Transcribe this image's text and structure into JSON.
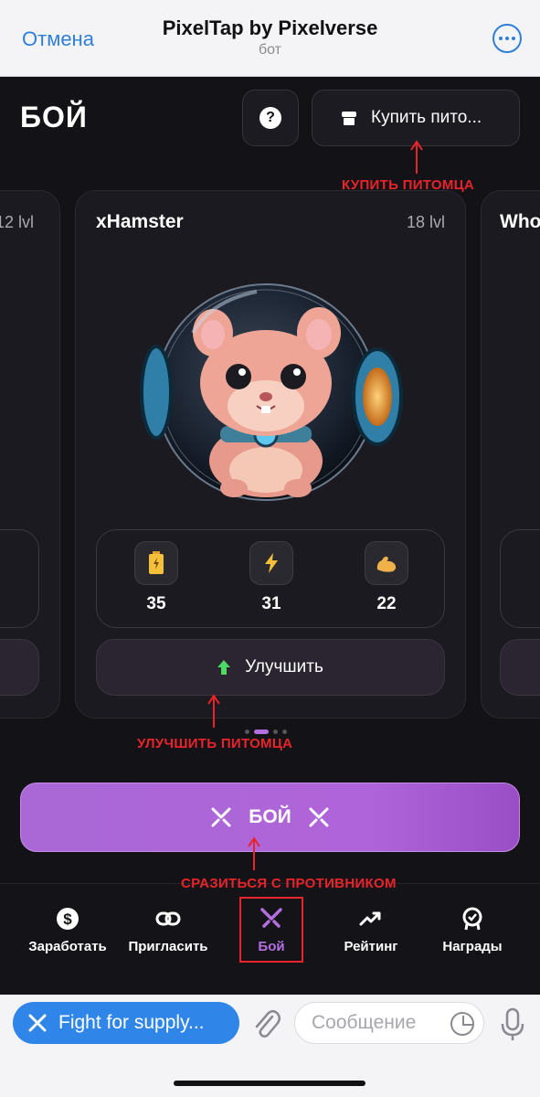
{
  "telegram_header": {
    "cancel_label": "Отмена",
    "title": "PixelTap by Pixelverse",
    "subtitle": "бот"
  },
  "app": {
    "page_title": "БОЙ",
    "help_label": "?",
    "buy_pet_label": "Купить пито...",
    "annotations": {
      "buy_pet": "КУПИТЬ ПИТОМЦА",
      "upgrade_pet": "УЛУЧШИТЬ ПИТОМЦА",
      "fight_opponent": "СРАЗИТЬСЯ С ПРОТИВНИКОМ"
    },
    "left_card": {
      "level": "12 lvl"
    },
    "right_card": {
      "name": "Who"
    },
    "main_card": {
      "name": "xHamster",
      "level": "18 lvl",
      "stats": [
        {
          "icon": "battery-icon",
          "value": "35"
        },
        {
          "icon": "lightning-icon",
          "value": "31"
        },
        {
          "icon": "muscle-icon",
          "value": "22"
        }
      ],
      "upgrade_label": "Улучшить"
    },
    "pagination": {
      "total": 4,
      "active_index": 1
    },
    "fight_label": "БОЙ"
  },
  "bottom_nav": {
    "items": [
      {
        "label": "Заработать",
        "icon": "dollar-icon"
      },
      {
        "label": "Пригласить",
        "icon": "link-icon"
      },
      {
        "label": "Бой",
        "icon": "swords-icon"
      },
      {
        "label": "Рейтинг",
        "icon": "trend-icon"
      },
      {
        "label": "Награды",
        "icon": "award-icon"
      }
    ],
    "active_index": 2
  },
  "telegram_input": {
    "chip_label": "Fight for supply...",
    "placeholder": "Сообщение"
  },
  "colors": {
    "accent_purple": "#b36ee0",
    "annotation_red": "#e8242a",
    "telegram_blue": "#2f86e8"
  }
}
